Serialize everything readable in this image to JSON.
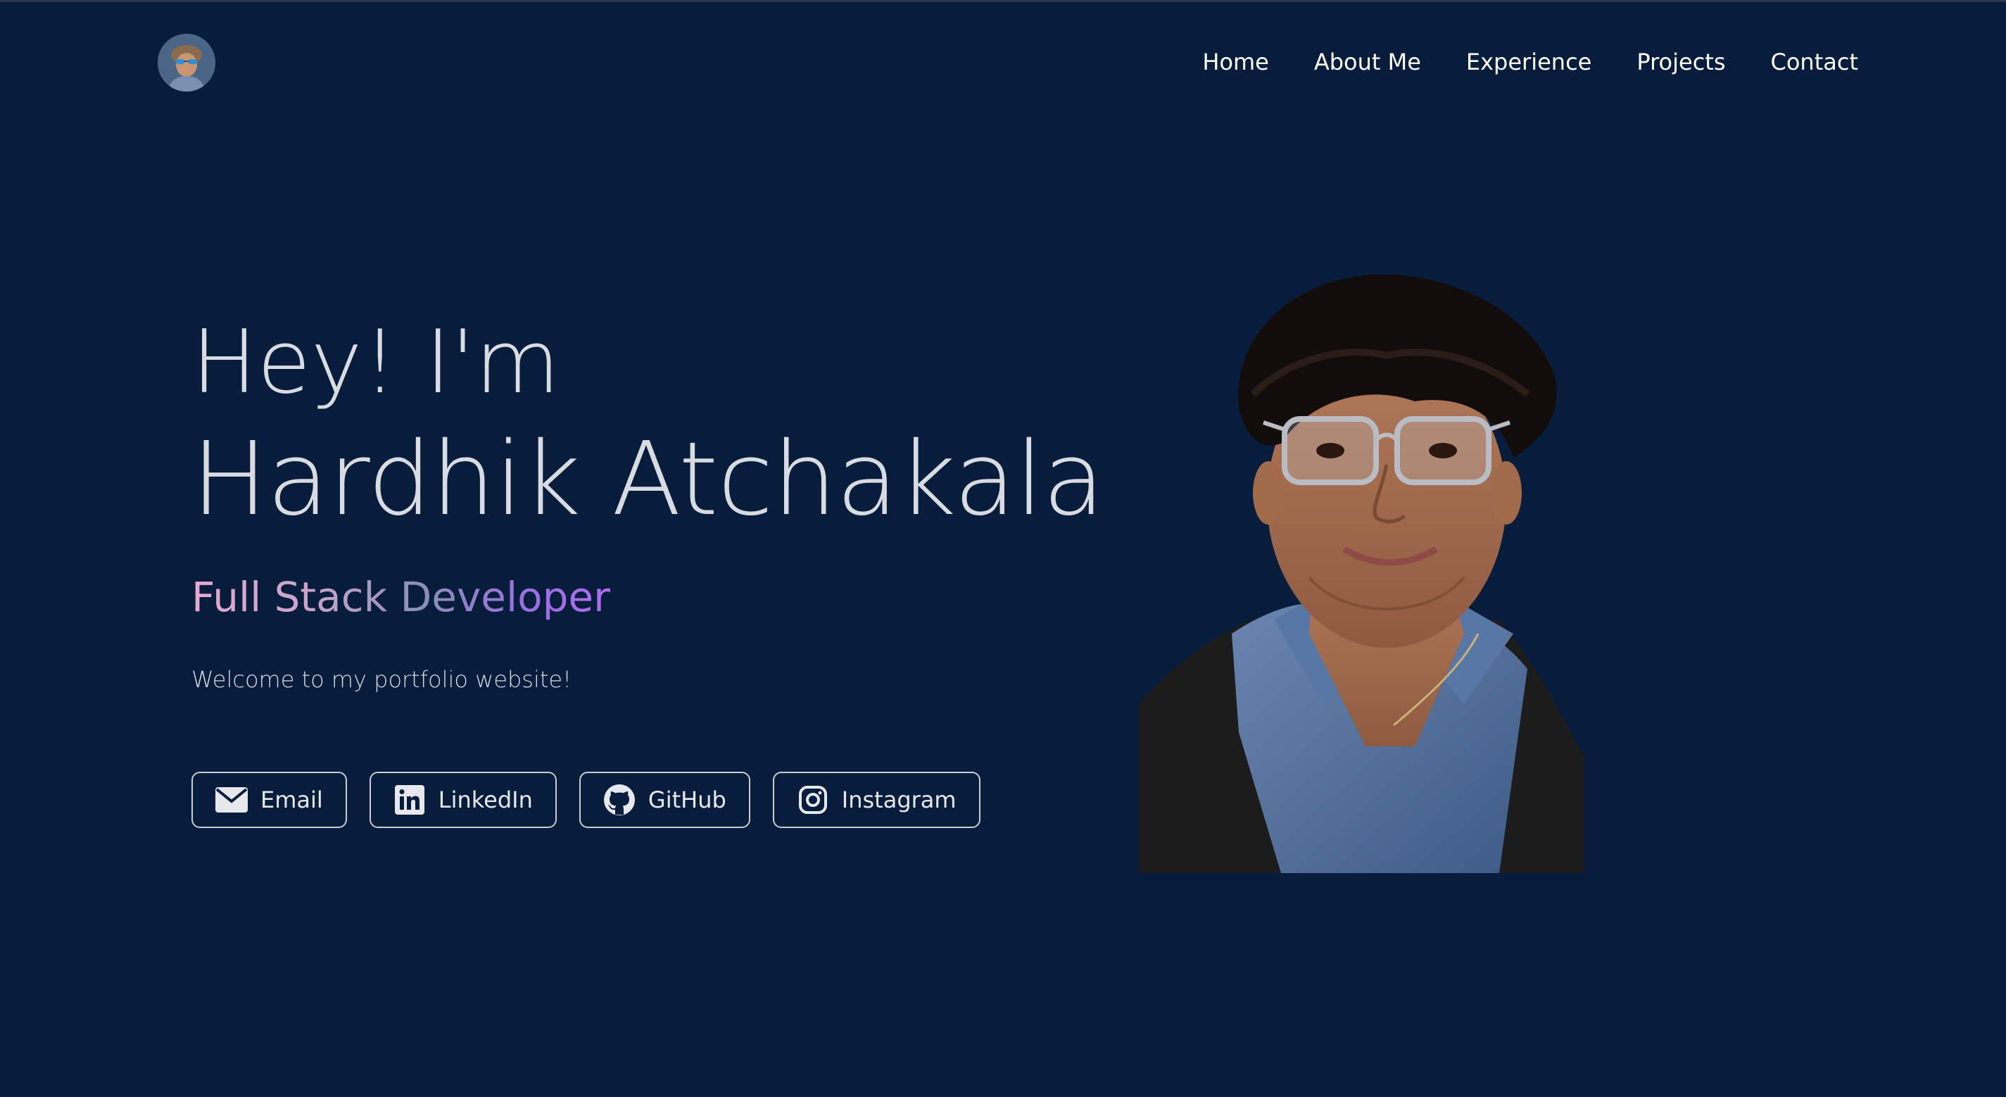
{
  "nav": {
    "items": [
      {
        "label": "Home"
      },
      {
        "label": "About Me"
      },
      {
        "label": "Experience"
      },
      {
        "label": "Projects"
      },
      {
        "label": "Contact"
      }
    ]
  },
  "hero": {
    "greeting": "Hey! I'm",
    "name": "Hardhik Atchakala",
    "role": "Full Stack Developer",
    "welcome": "Welcome to my portfolio website!"
  },
  "socials": [
    {
      "label": "Email",
      "icon": "envelope-icon"
    },
    {
      "label": "LinkedIn",
      "icon": "linkedin-icon"
    },
    {
      "label": "GitHub",
      "icon": "github-icon"
    },
    {
      "label": "Instagram",
      "icon": "instagram-icon"
    }
  ],
  "colors": {
    "background": "#081d3c",
    "text": "#d8dbe2",
    "accent_gradient_start": "#e8a8d6",
    "accent_gradient_end": "#b06cf0",
    "button_border": "#c8ccd4"
  }
}
